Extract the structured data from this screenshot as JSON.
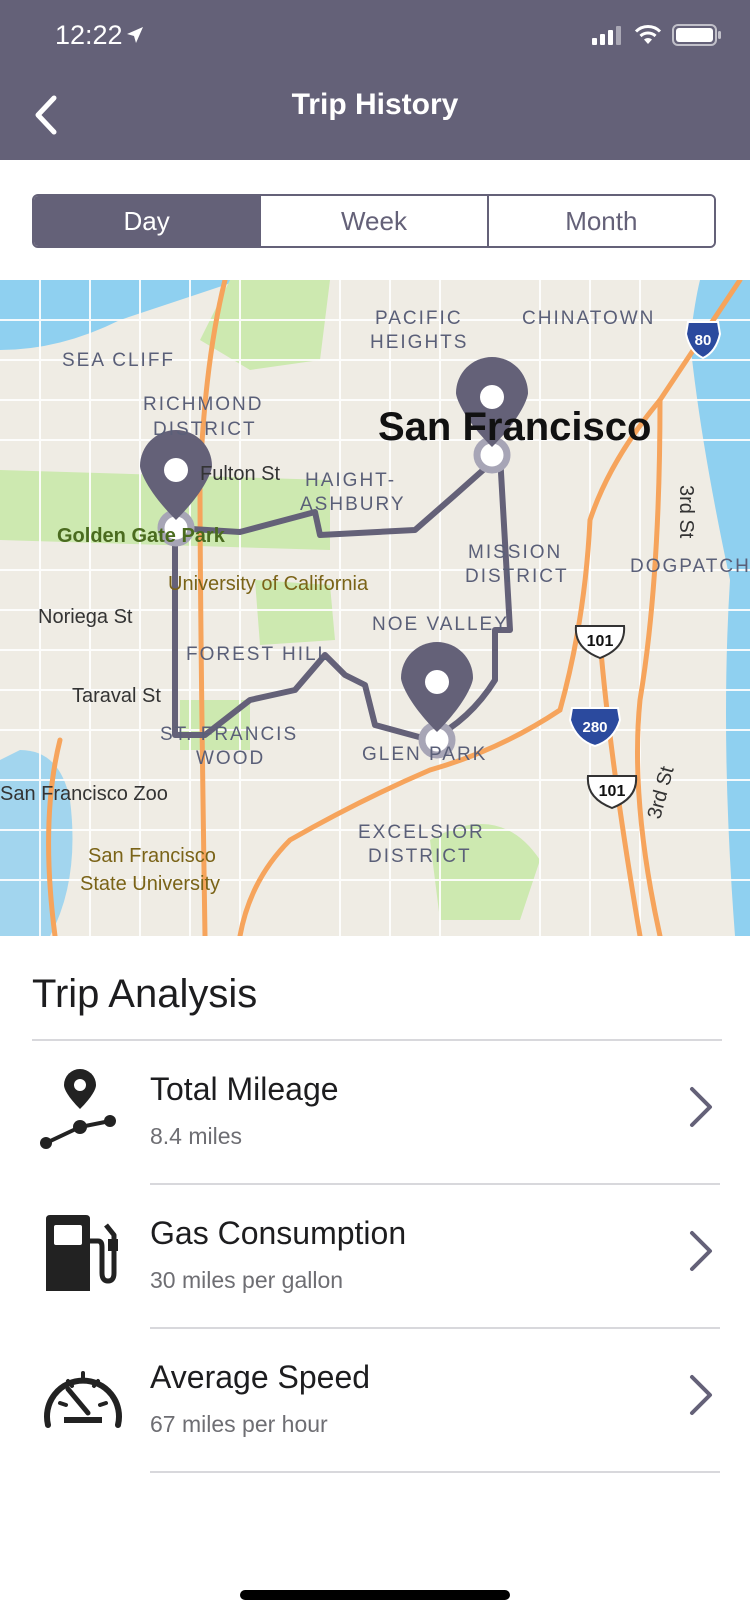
{
  "status_bar": {
    "time": "12:22"
  },
  "header": {
    "title": "Trip History",
    "back_icon": "chevron-left-icon"
  },
  "segments": [
    {
      "label": "Day",
      "active": true
    },
    {
      "label": "Week",
      "active": false
    },
    {
      "label": "Month",
      "active": false
    }
  ],
  "map": {
    "labels": {
      "sea_cliff": "SEA CLIFF",
      "richmond_1": "RICHMOND",
      "richmond_2": "DISTRICT",
      "pacific_1": "PACIFIC",
      "pacific_2": "HEIGHTS",
      "chinatown": "CHINATOWN",
      "sf_city": "San Francisco",
      "fulton": "Fulton St",
      "haight_1": "HAIGHT-",
      "haight_2": "ASHBURY",
      "ggpark": "Golden Gate Park",
      "ucsf": "University of California",
      "mission_1": "MISSION",
      "mission_2": "DISTRICT",
      "dogpatch": "DOGPATCH",
      "third_st_1": "3rd St",
      "third_st_2": "3rd St",
      "noriega": "Noriega St",
      "noe": "NOE VALLEY",
      "forest": "FOREST HILL",
      "taraval": "Taraval St",
      "stfrancis_1": "ST. FRANCIS",
      "stfrancis_2": "WOOD",
      "glenpark": "GLEN PARK",
      "zoo": "San Francisco Zoo",
      "excelsior_1": "EXCELSIOR",
      "excelsior_2": "DISTRICT",
      "sfsu_1": "San Francisco",
      "sfsu_2": "State University",
      "shield_80": "80",
      "shield_280": "280",
      "shield_101_a": "101",
      "shield_101_b": "101"
    }
  },
  "analysis": {
    "title": "Trip Analysis",
    "items": [
      {
        "icon": "route-pin-icon",
        "title": "Total Mileage",
        "subtitle": "8.4 miles"
      },
      {
        "icon": "gas-pump-icon",
        "title": "Gas Consumption",
        "subtitle": "30 miles per gallon"
      },
      {
        "icon": "speedometer-icon",
        "title": "Average Speed",
        "subtitle": "67 miles per hour"
      }
    ]
  },
  "colors": {
    "header": "#646178",
    "route": "#646178",
    "highway": "#f6a45c",
    "water": "#8fd0f0",
    "park": "#cde9b0"
  }
}
